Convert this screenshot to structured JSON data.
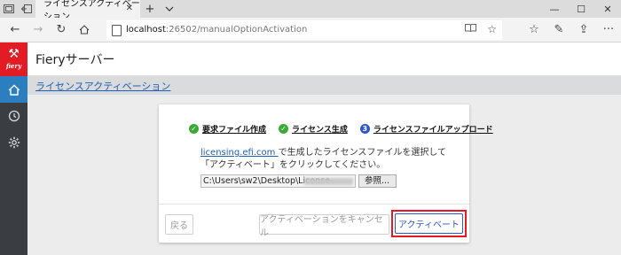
{
  "browser": {
    "tab_title": "ライセンスアクティベーション",
    "url_host": "localhost",
    "url_path": ":26502/manualOptionActivation"
  },
  "app": {
    "logo_text": "fiery",
    "title": "Fieryサーバー"
  },
  "breadcrumb": {
    "label": "ライセンスアクティベーション"
  },
  "steps": [
    {
      "number": "1",
      "label": "要求ファイル作成",
      "state": "done"
    },
    {
      "number": "2",
      "label": "ライセンス生成",
      "state": "done"
    },
    {
      "number": "3",
      "label": "ライセンスファイルアップロード",
      "state": "current"
    }
  ],
  "dialog": {
    "link_text": "licensing.efi.com ",
    "description": "で生成したライセンスファイルを選択して「アクティベート」をクリックしてください。",
    "file_path": "C:\\Users\\sw2\\Desktop\\License-",
    "browse_label": "参照...",
    "back_label": "戻る",
    "cancel_label": "アクティベーションをキャンセル",
    "activate_label": "アクティベート"
  },
  "colors": {
    "brand_red": "#e21b25",
    "accent_blue": "#2b7fc1",
    "step_done": "#3aaa35",
    "step_current": "#2f56c6"
  }
}
